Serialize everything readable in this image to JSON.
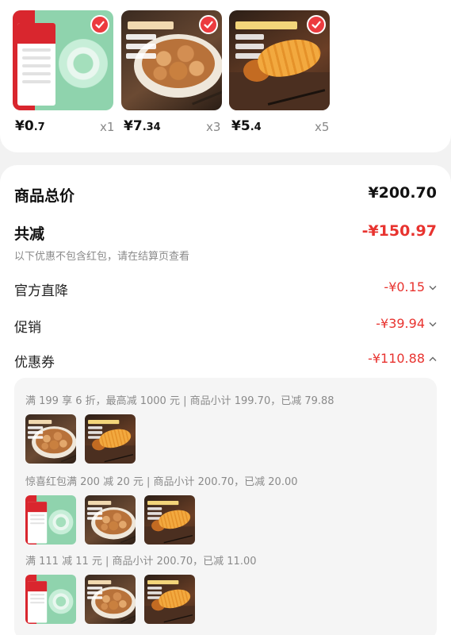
{
  "products": [
    {
      "price_symbol": "¥",
      "price_int": "0",
      "price_dec": ".7",
      "qty": "x1",
      "icon": "tape-product"
    },
    {
      "price_symbol": "¥",
      "price_int": "7",
      "price_dec": ".34",
      "qty": "x3",
      "icon": "mushroom-product"
    },
    {
      "price_symbol": "¥",
      "price_int": "5",
      "price_dec": ".4",
      "qty": "x5",
      "icon": "squid-product"
    }
  ],
  "summary": {
    "total_label": "商品总价",
    "total_value": "¥200.70",
    "discount_label": "共减",
    "discount_value": "-¥150.97",
    "note": "以下优惠不包含红包，请在结算页查看",
    "official_label": "官方直降",
    "official_value": "-¥0.15",
    "promo_label": "促销",
    "promo_value": "-¥39.94",
    "coupon_label": "优惠券",
    "coupon_value": "-¥110.88"
  },
  "coupons": [
    {
      "text": "满 199 享 6 折，最高减 1000 元 | 商品小计 199.70，已减 79.88"
    },
    {
      "text": "惊喜红包满 200 减 20 元 | 商品小计 200.70，已减 20.00"
    },
    {
      "text": "满 111 减 11 元 | 商品小计 200.70，已减 11.00"
    }
  ],
  "colors": {
    "accent": "#e8332f",
    "check": "#ec3b3f"
  }
}
